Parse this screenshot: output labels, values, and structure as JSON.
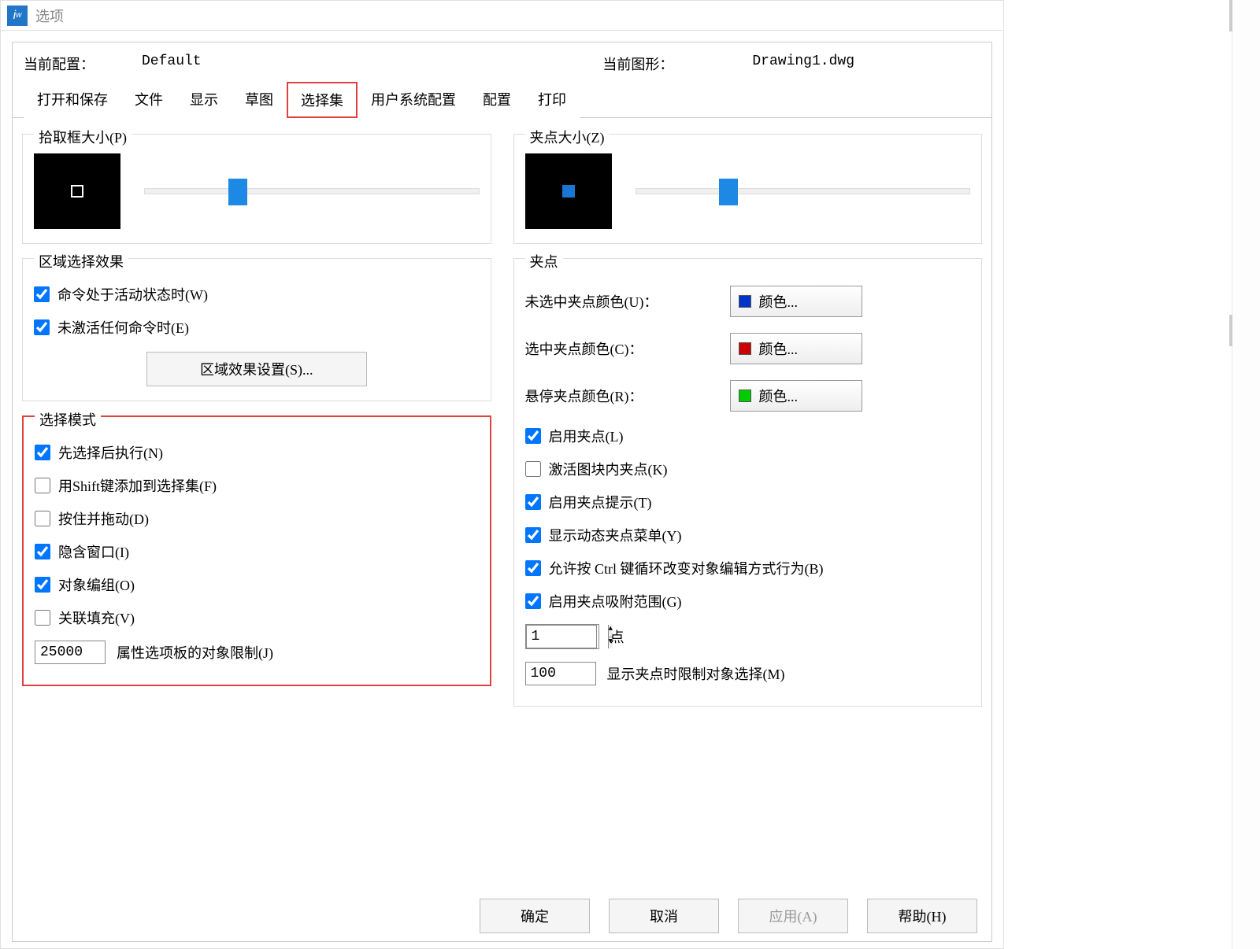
{
  "window": {
    "title": "选项"
  },
  "info": {
    "profile_label": "当前配置：",
    "profile_value": "Default",
    "drawing_label": "当前图形：",
    "drawing_value": "Drawing1.dwg"
  },
  "tabs": {
    "open_save": "打开和保存",
    "file": "文件",
    "display": "显示",
    "sketch": "草图",
    "selection": "选择集",
    "user_system": "用户系统配置",
    "config": "配置",
    "print": "打印"
  },
  "left": {
    "pickbox": {
      "title": "拾取框大小(P)"
    },
    "area_effect": {
      "title": "区域选择效果",
      "when_command_active": "命令处于活动状态时(W)",
      "when_no_command": "未激活任何命令时(E)",
      "settings_btn": "区域效果设置(S)..."
    },
    "select_mode": {
      "title": "选择模式",
      "noun_verb": "先选择后执行(N)",
      "use_shift": "用Shift键添加到选择集(F)",
      "press_drag": "按住并拖动(D)",
      "implied_window": "隐含窗口(I)",
      "object_group": "对象编组(O)",
      "assoc_hatch": "关联填充(V)",
      "limit_value": "25000",
      "limit_label": "属性选项板的对象限制(J)"
    }
  },
  "right": {
    "gripsize": {
      "title": "夹点大小(Z)"
    },
    "grips": {
      "title": "夹点",
      "unselected_label": "未选中夹点颜色(U)：",
      "selected_label": "选中夹点颜色(C)：",
      "hover_label": "悬停夹点颜色(R)：",
      "color_btn": "颜色...",
      "enable_grips": "启用夹点(L)",
      "block_grips": "激活图块内夹点(K)",
      "grip_tips": "启用夹点提示(T)",
      "dynamic_menu": "显示动态夹点菜单(Y)",
      "ctrl_cycle": "允许按 Ctrl 键循环改变对象编辑方式行为(B)",
      "snap_range": "启用夹点吸附范围(G)",
      "points_value": "1",
      "points_label": "点",
      "limit_value": "100",
      "limit_label": "显示夹点时限制对象选择(M)"
    }
  },
  "footer": {
    "ok": "确定",
    "cancel": "取消",
    "apply": "应用(A)",
    "help": "帮助(H)"
  }
}
